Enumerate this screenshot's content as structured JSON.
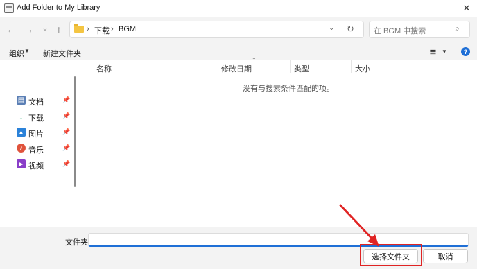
{
  "window": {
    "title": "Add Folder to My Library",
    "close_glyph": "✕"
  },
  "nav": {
    "back_glyph": "←",
    "forward_glyph": "→",
    "recent_glyph": "⌄",
    "up_glyph": "↑",
    "breadcrumbs": [
      "下载",
      "BGM"
    ],
    "separator": "›",
    "dropdown_glyph": "⌄",
    "refresh_glyph": "↻",
    "search_placeholder": "在 BGM 中搜索",
    "search_glyph": "⌕"
  },
  "toolbar": {
    "organize_label": "组织",
    "organize_caret": "▼",
    "new_folder_label": "新建文件夹",
    "view_glyph": "≣",
    "view_caret": "▼",
    "help_glyph": "?"
  },
  "quick_access": [
    {
      "label": "文档",
      "icon": "documents-icon",
      "glyph": "▤",
      "color": "#5b7fb5",
      "pin": "📌"
    },
    {
      "label": "下载",
      "icon": "download-icon",
      "glyph": "↓",
      "color": "#1aa06a",
      "pin": "📌"
    },
    {
      "label": "图片",
      "icon": "pictures-icon",
      "glyph": "▲",
      "color": "#2b82d9",
      "pin": "📌"
    },
    {
      "label": "音乐",
      "icon": "music-icon",
      "glyph": "♪",
      "color": "#e0533c",
      "pin": "📌"
    },
    {
      "label": "视频",
      "icon": "videos-icon",
      "glyph": "▶",
      "color": "#8a3fc9",
      "pin": "📌"
    }
  ],
  "file_list": {
    "columns": [
      "名称",
      "修改日期",
      "类型",
      "大小"
    ],
    "sort_glyph": "⌃",
    "empty_message": "没有与搜索条件匹配的项。"
  },
  "footer": {
    "folder_label": "文件夹:",
    "folder_value": "",
    "select_button": "选择文件夹",
    "cancel_button": "取消"
  },
  "colors": {
    "accent": "#1f6fd6",
    "annotation": "#e02424"
  }
}
